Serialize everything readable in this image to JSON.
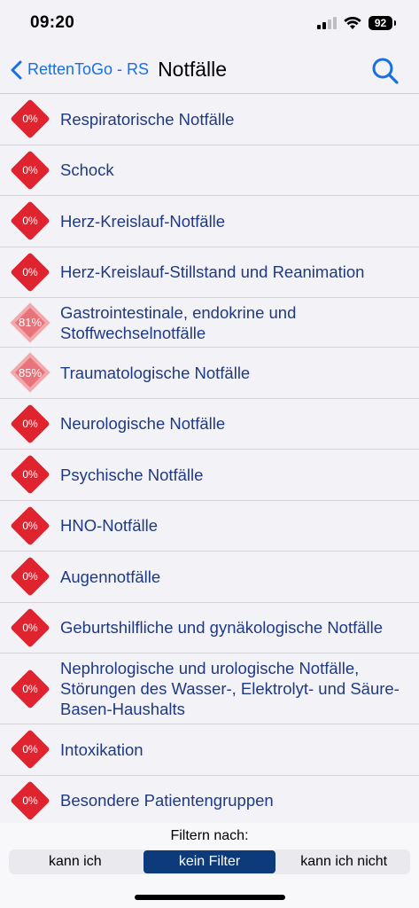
{
  "status": {
    "time": "09:20",
    "battery": "92"
  },
  "nav": {
    "back_label": "RettenToGo - RS",
    "title": "Notfälle"
  },
  "items": [
    {
      "label": "Respiratorische Notfälle",
      "progress": "0%"
    },
    {
      "label": "Schock",
      "progress": "0%"
    },
    {
      "label": "Herz-Kreislauf-Notfälle",
      "progress": "0%"
    },
    {
      "label": "Herz-Kreislauf-Stillstand und Reanimation",
      "progress": "0%"
    },
    {
      "label": "Gastrointestinale, endokrine und Stoffwechselnotfälle",
      "progress": "81%"
    },
    {
      "label": "Traumatologische Notfälle",
      "progress": "85%"
    },
    {
      "label": "Neurologische Notfälle",
      "progress": "0%"
    },
    {
      "label": "Psychische Notfälle",
      "progress": "0%"
    },
    {
      "label": "HNO-Notfälle",
      "progress": "0%"
    },
    {
      "label": "Augennotfälle",
      "progress": "0%"
    },
    {
      "label": "Geburtshilfliche und gynäkologische Notfälle",
      "progress": "0%"
    },
    {
      "label": "Nephrologische und urologische Notfälle, Störungen des Wasser-, Elektrolyt- und Säure-Basen-Haushalts",
      "progress": "0%"
    },
    {
      "label": "Intoxikation",
      "progress": "0%"
    },
    {
      "label": "Besondere Patientengruppen",
      "progress": "0%"
    }
  ],
  "filter": {
    "title": "Filtern nach:",
    "options": [
      "kann ich",
      "kein Filter",
      "kann ich nicht"
    ],
    "selected": "kein Filter"
  },
  "colors": {
    "accent": "#1a6fe0",
    "badge_red": "#e0242f",
    "badge_light": "#f3a8ab",
    "label_blue": "#1f3a82",
    "segment_active": "#0d3a7a"
  }
}
